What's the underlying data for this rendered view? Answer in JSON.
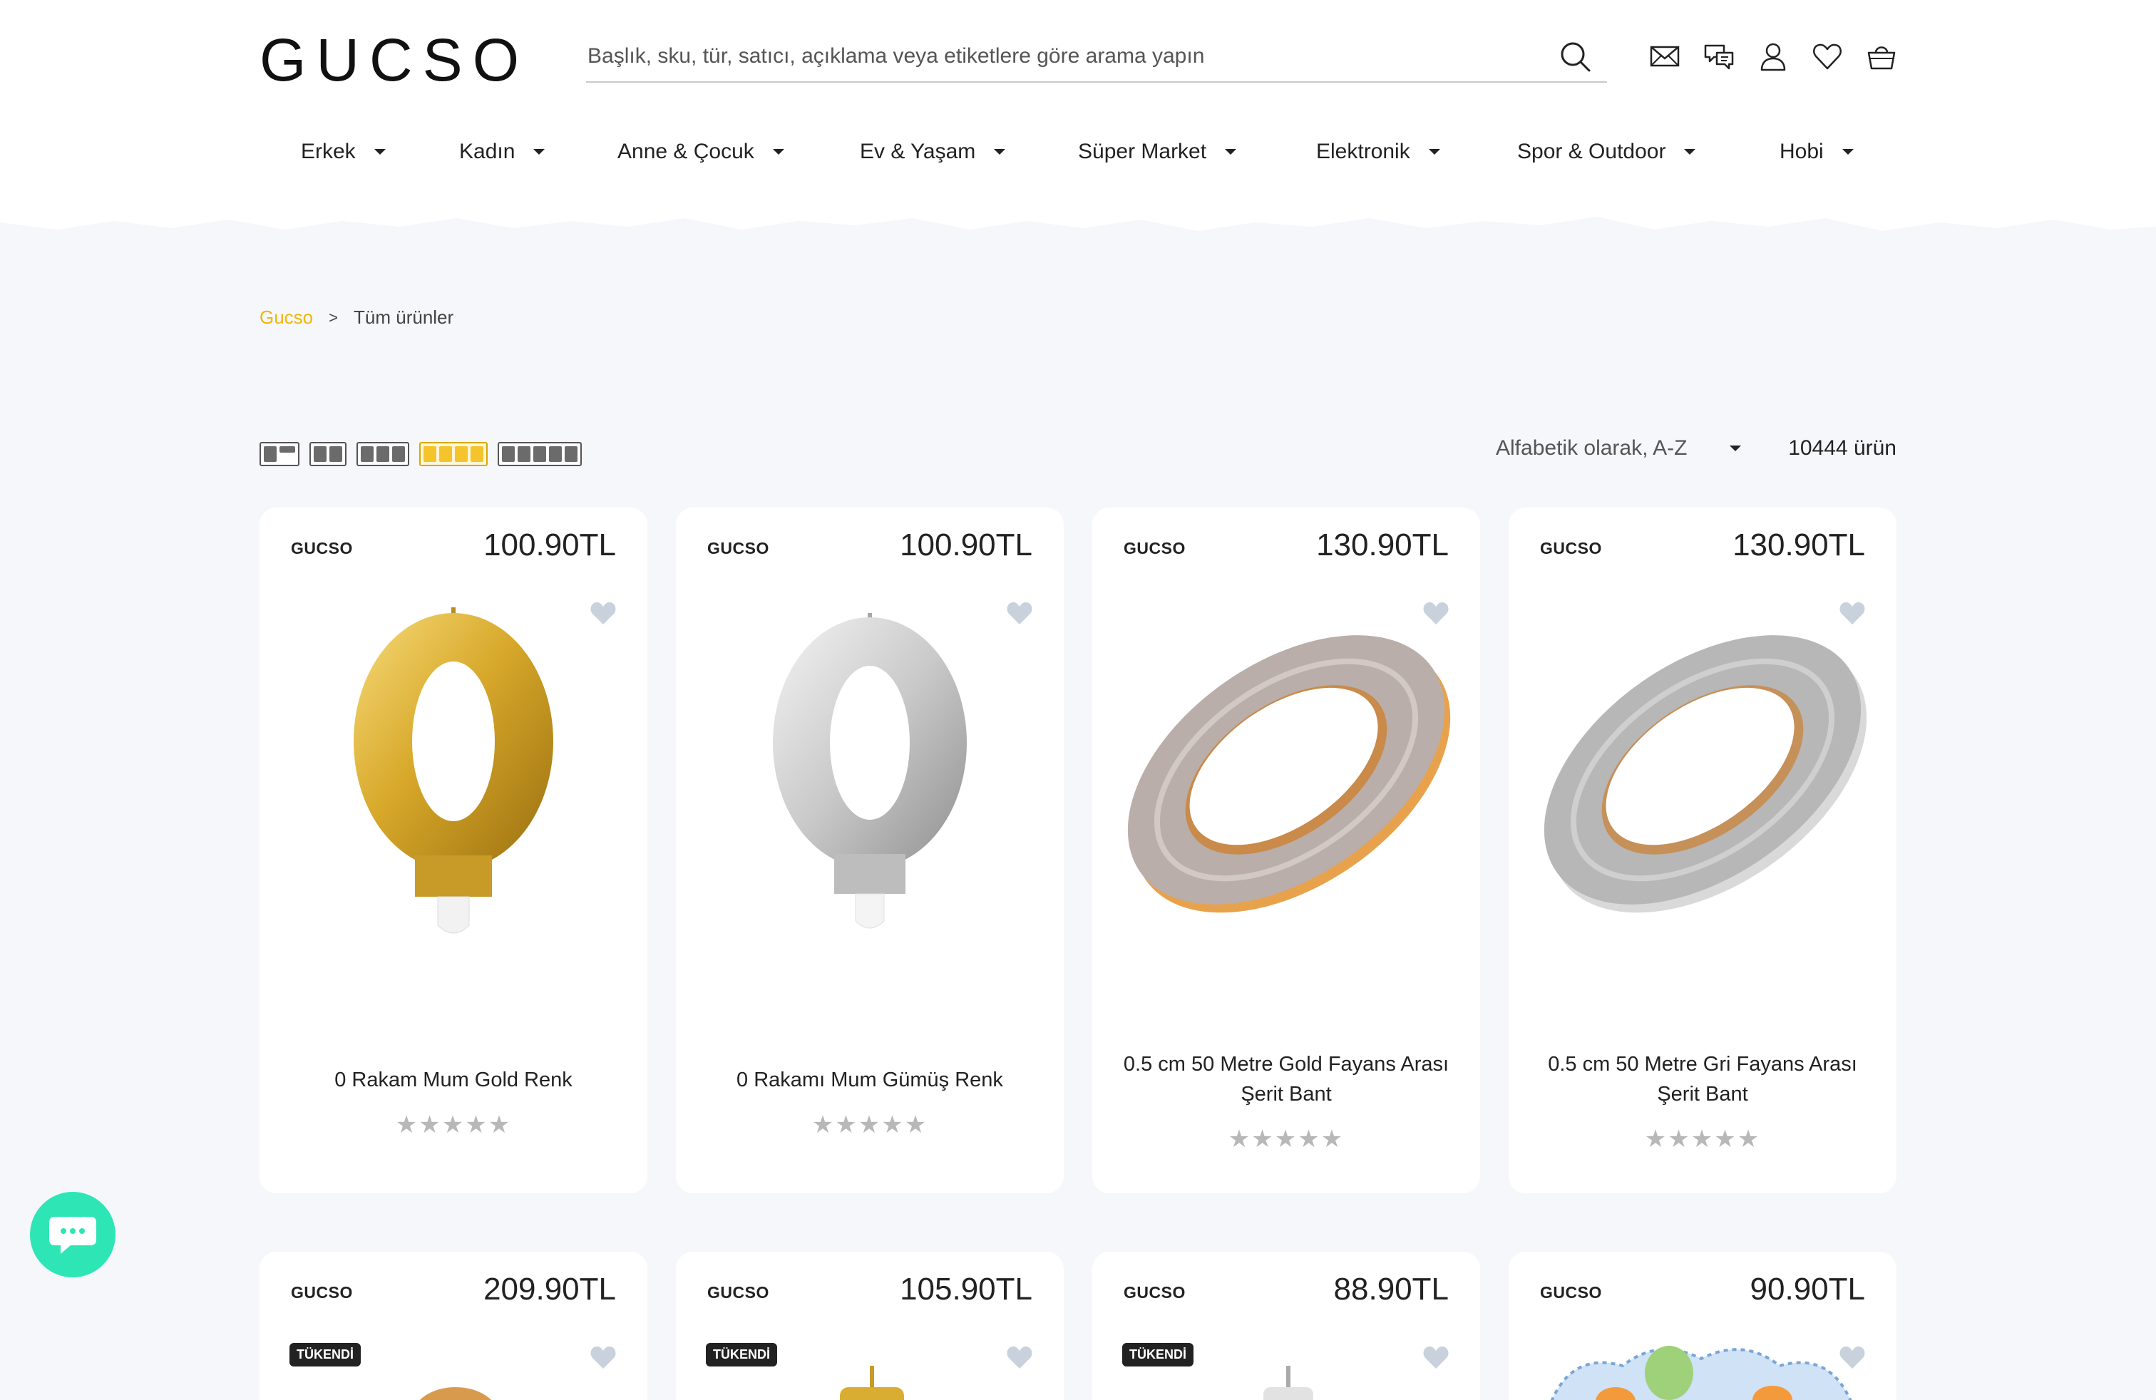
{
  "header": {
    "logo": "GUCSO",
    "search_placeholder": "Başlık, sku, tür, satıcı, açıklama veya etiketlere göre arama yapın"
  },
  "nav": [
    {
      "label": "Erkek"
    },
    {
      "label": "Kadın"
    },
    {
      "label": "Anne & Çocuk"
    },
    {
      "label": "Ev & Yaşam"
    },
    {
      "label": "Süper Market"
    },
    {
      "label": "Elektronik"
    },
    {
      "label": "Spor & Outdoor"
    },
    {
      "label": "Hobi"
    }
  ],
  "breadcrumb": {
    "home": "Gucso",
    "separator": ">",
    "current": "Tüm ürünler"
  },
  "toolbar": {
    "sort_label": "Alfabetik olarak, A-Z",
    "count": "10444 ürün",
    "grid_active": "4 columns"
  },
  "products": [
    {
      "brand": "GUCSO",
      "price": "100.90TL",
      "title": "0 Rakam Mum Gold Renk",
      "stars": "★★★★★",
      "image": "gold-candle-0"
    },
    {
      "brand": "GUCSO",
      "price": "100.90TL",
      "title": "0 Rakamı Mum Gümüş Renk",
      "stars": "★★★★★",
      "image": "silver-candle-0"
    },
    {
      "brand": "GUCSO",
      "price": "130.90TL",
      "title": "0.5 cm 50 Metre Gold Fayans Arası Şerit Bant",
      "stars": "★★★★★",
      "image": "gold-tape-roll"
    },
    {
      "brand": "GUCSO",
      "price": "130.90TL",
      "title": "0.5 cm 50 Metre Gri Fayans Arası Şerit Bant",
      "stars": "★★★★★",
      "image": "silver-tape-roll"
    },
    {
      "brand": "GUCSO",
      "price": "209.90TL",
      "badge": "TÜKENDİ"
    },
    {
      "brand": "GUCSO",
      "price": "105.90TL",
      "badge": "TÜKENDİ"
    },
    {
      "brand": "GUCSO",
      "price": "88.90TL",
      "badge": "TÜKENDİ"
    },
    {
      "brand": "GUCSO",
      "price": "90.90TL"
    }
  ],
  "colors": {
    "accent": "#f2b600",
    "chat": "#2ee6b5",
    "background": "#f6f7fb"
  }
}
